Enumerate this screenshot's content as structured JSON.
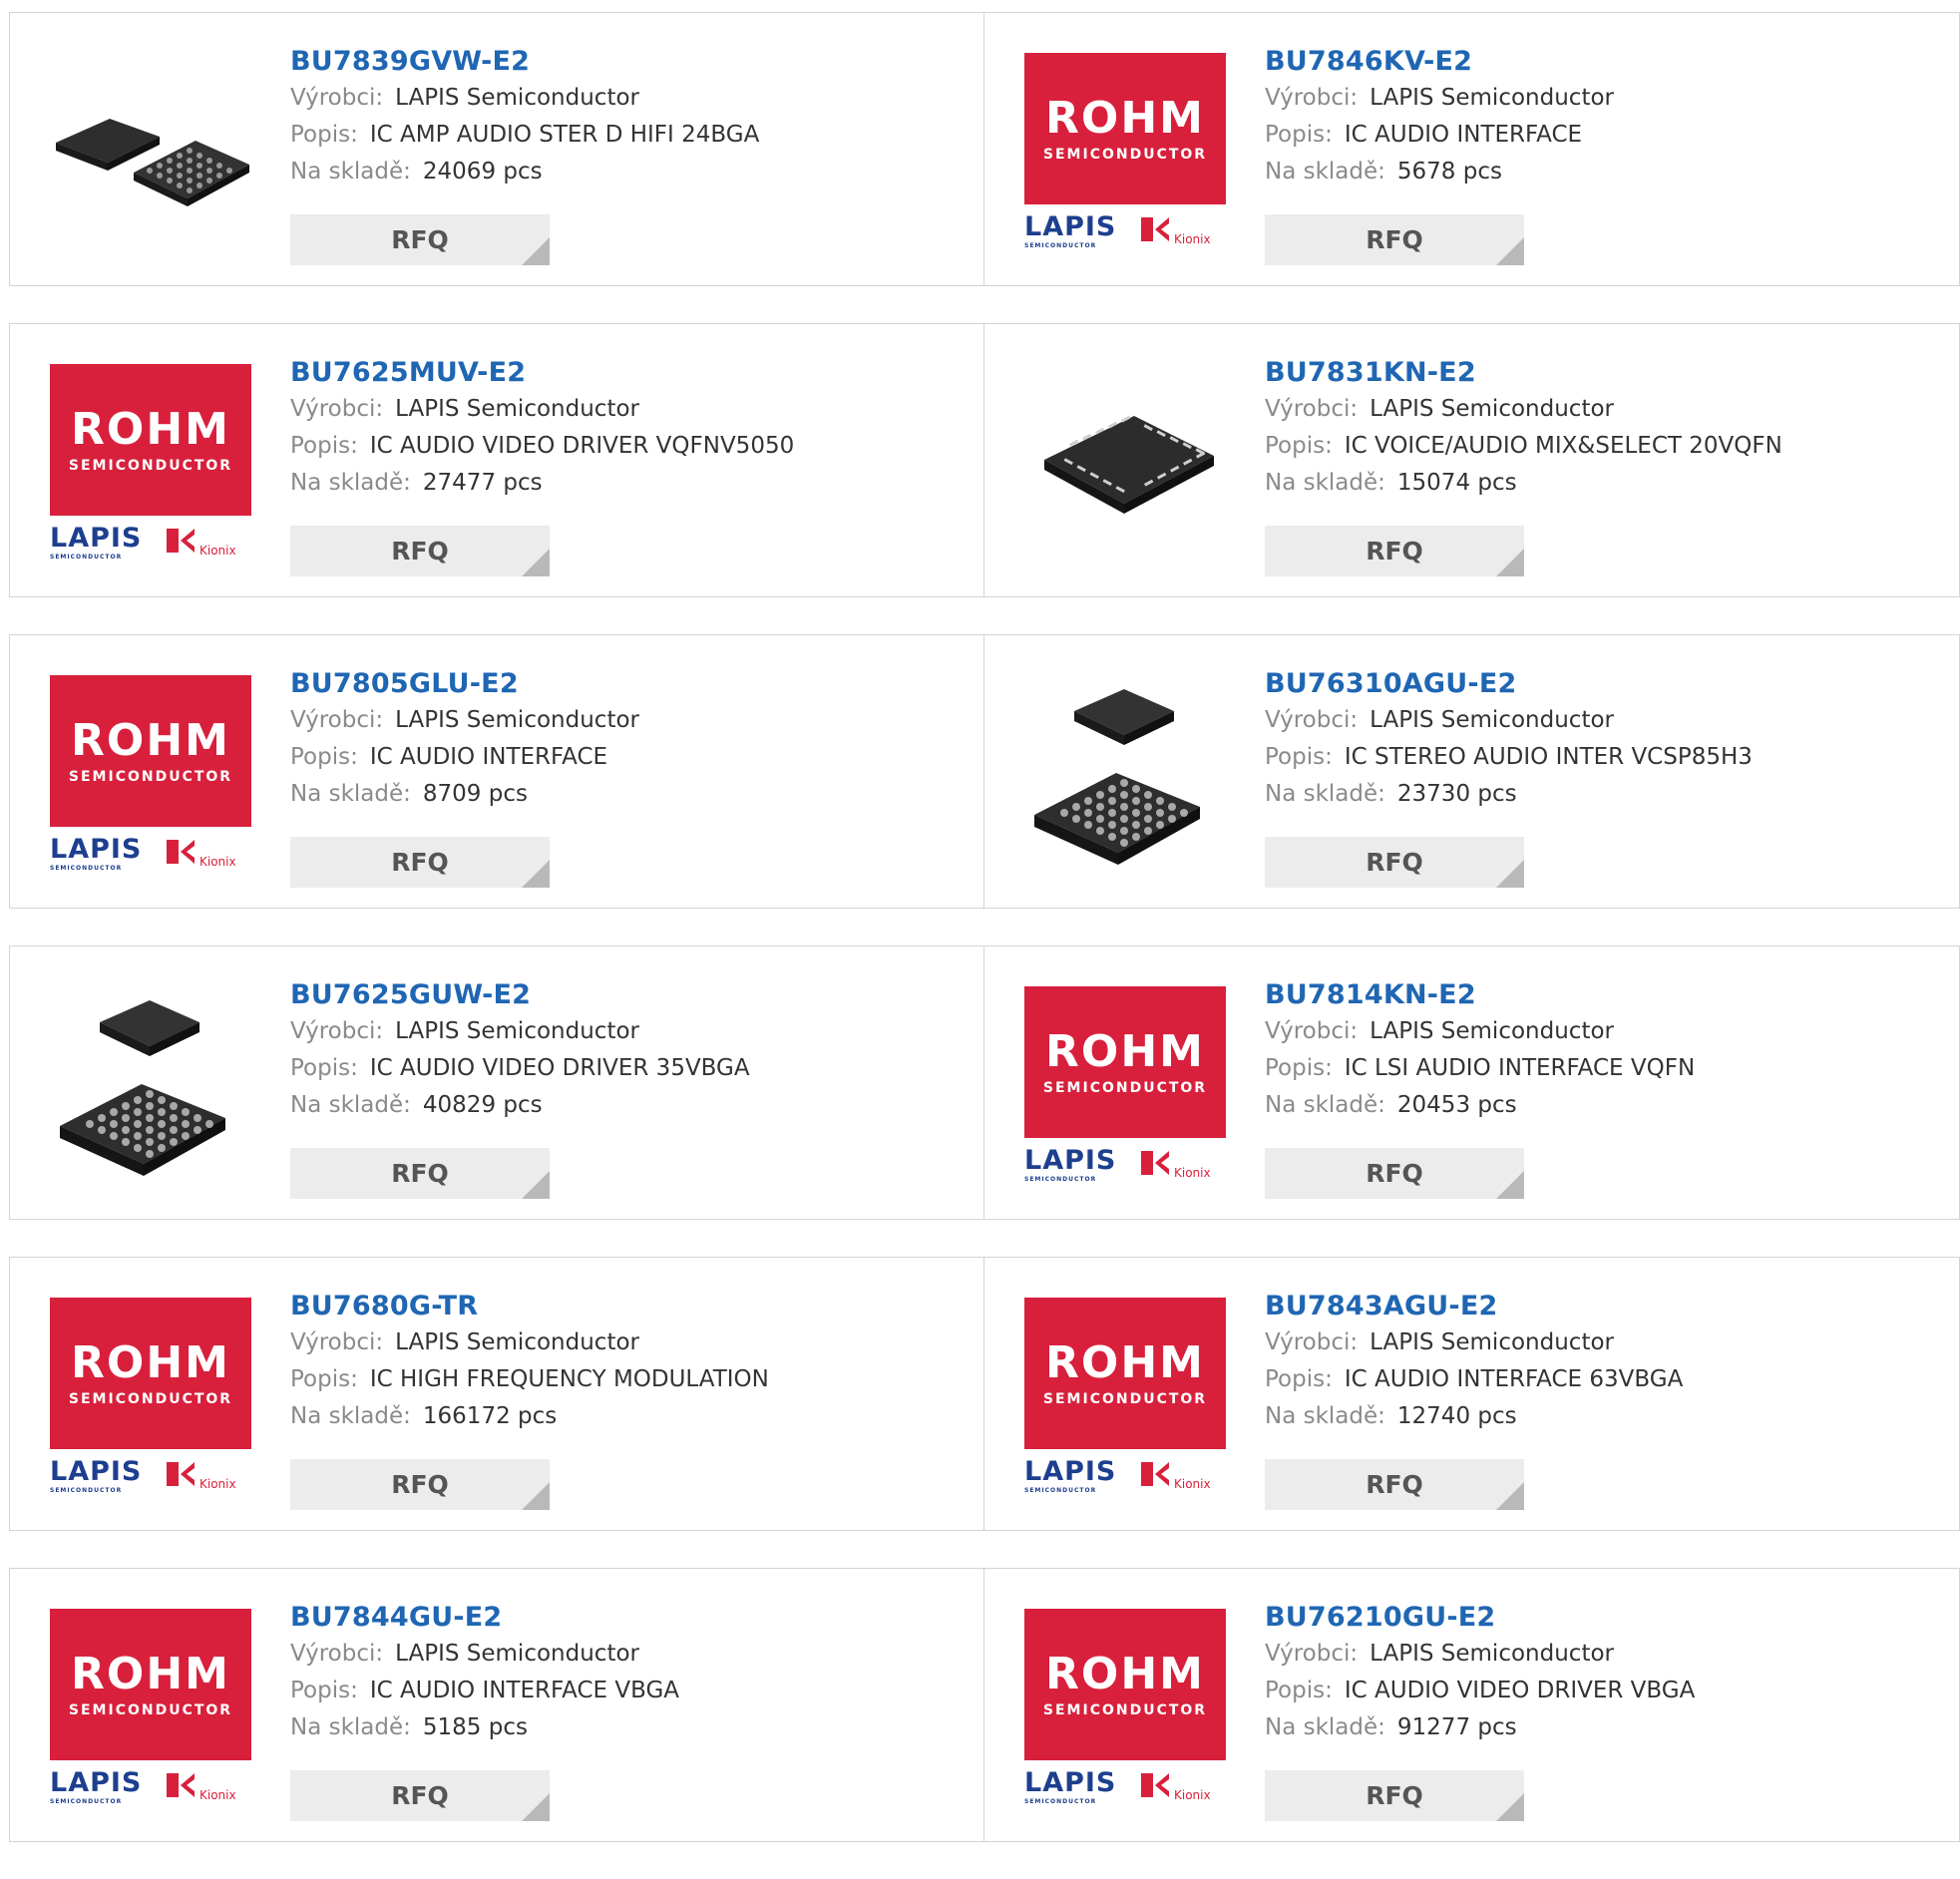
{
  "labels": {
    "manufacturer": "Výrobci:",
    "description": "Popis:",
    "stock": "Na skladě:",
    "rfq": "RFQ"
  },
  "logo": {
    "brand": "ROHM",
    "brand_sub": "SEMICONDUCTOR",
    "lapis": "LAPIS",
    "lapis_sub": "SEMICONDUCTOR",
    "kionix": "Kionix"
  },
  "products": [
    {
      "part": "BU7839GVW-E2",
      "manufacturer": "LAPIS Semiconductor",
      "description": "IC AMP AUDIO STER D HIFI 24BGA",
      "stock": "24069 pcs",
      "image": "bga-chip-pair"
    },
    {
      "part": "BU7846KV-E2",
      "manufacturer": "LAPIS Semiconductor",
      "description": "IC AUDIO INTERFACE",
      "stock": "5678 pcs",
      "image": "rohm-logo"
    },
    {
      "part": "BU7625MUV-E2",
      "manufacturer": "LAPIS Semiconductor",
      "description": "IC AUDIO VIDEO DRIVER VQFNV5050",
      "stock": "27477 pcs",
      "image": "rohm-logo"
    },
    {
      "part": "BU7831KN-E2",
      "manufacturer": "LAPIS Semiconductor",
      "description": "IC VOICE/AUDIO MIX&SELECT 20VQFN",
      "stock": "15074 pcs",
      "image": "qfn-chip"
    },
    {
      "part": "BU7805GLU-E2",
      "manufacturer": "LAPIS Semiconductor",
      "description": "IC AUDIO INTERFACE",
      "stock": "8709 pcs",
      "image": "rohm-logo"
    },
    {
      "part": "BU76310AGU-E2",
      "manufacturer": "LAPIS Semiconductor",
      "description": "IC STEREO AUDIO INTER VCSP85H3",
      "stock": "23730 pcs",
      "image": "bga-chip-stack"
    },
    {
      "part": "BU7625GUW-E2",
      "manufacturer": "LAPIS Semiconductor",
      "description": "IC AUDIO VIDEO DRIVER 35VBGA",
      "stock": "40829 pcs",
      "image": "bga-chip-stack"
    },
    {
      "part": "BU7814KN-E2",
      "manufacturer": "LAPIS Semiconductor",
      "description": "IC LSI AUDIO INTERFACE VQFN",
      "stock": "20453 pcs",
      "image": "rohm-logo"
    },
    {
      "part": "BU7680G-TR",
      "manufacturer": "LAPIS Semiconductor",
      "description": "IC HIGH FREQUENCY MODULATION",
      "stock": "166172 pcs",
      "image": "rohm-logo"
    },
    {
      "part": "BU7843AGU-E2",
      "manufacturer": "LAPIS Semiconductor",
      "description": "IC AUDIO INTERFACE 63VBGA",
      "stock": "12740 pcs",
      "image": "rohm-logo"
    },
    {
      "part": "BU7844GU-E2",
      "manufacturer": "LAPIS Semiconductor",
      "description": "IC AUDIO INTERFACE VBGA",
      "stock": "5185 pcs",
      "image": "rohm-logo"
    },
    {
      "part": "BU76210GU-E2",
      "manufacturer": "LAPIS Semiconductor",
      "description": "IC AUDIO VIDEO DRIVER VBGA",
      "stock": "91277 pcs",
      "image": "rohm-logo"
    }
  ]
}
